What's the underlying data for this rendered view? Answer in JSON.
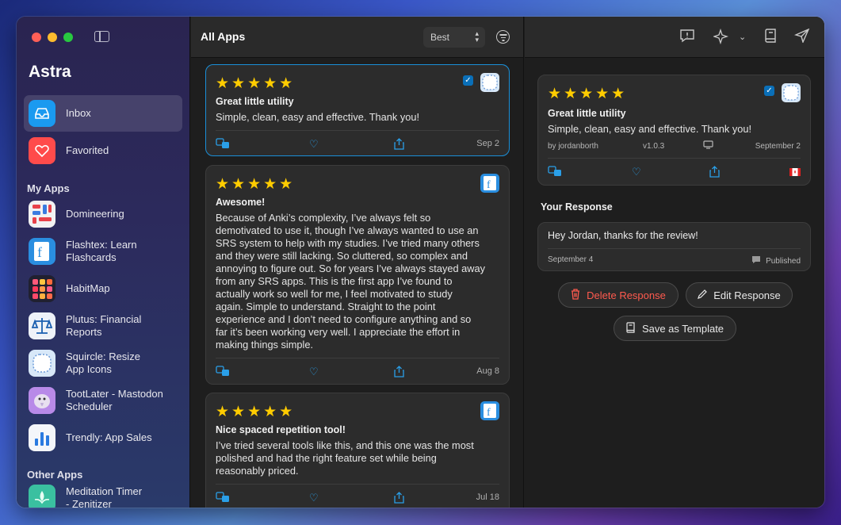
{
  "app": {
    "name": "Astra"
  },
  "sidebar": {
    "top_items": [
      {
        "label": "Inbox",
        "icon": "inbox-icon",
        "active": true
      },
      {
        "label": "Favorited",
        "icon": "heart-icon",
        "active": false
      }
    ],
    "my_apps_heading": "My Apps",
    "my_apps": [
      {
        "label": "Domineering",
        "icon": "domineering-app-icon"
      },
      {
        "label": "Flashtex: Learn Flashcards",
        "line1": "Flashtex: Learn",
        "line2": "Flashcards",
        "icon": "flashtex-app-icon"
      },
      {
        "label": "HabitMap",
        "icon": "habitmap-app-icon"
      },
      {
        "label": "Plutus: Financial Reports",
        "line1": "Plutus: Financial",
        "line2": "Reports",
        "icon": "plutus-app-icon"
      },
      {
        "label": "Squircle: Resize App Icons",
        "line1": "Squircle: Resize",
        "line2": "App Icons",
        "icon": "squircle-app-icon"
      },
      {
        "label": "TootLater - Mastodon Scheduler",
        "line1": "TootLater - Mastodon",
        "line2": "Scheduler",
        "icon": "tootlater-app-icon"
      },
      {
        "label": "Trendly: App Sales",
        "icon": "trendly-app-icon"
      }
    ],
    "other_apps_heading": "Other Apps",
    "other_apps": [
      {
        "line1": "Meditation Timer",
        "line2": "- Zenitizer",
        "icon": "meditation-app-icon"
      }
    ]
  },
  "list": {
    "title": "All Apps",
    "sort_value": "Best",
    "reviews": [
      {
        "stars": "★★★★★",
        "title": "Great little utility",
        "body": "Simple, clean, easy and effective. Thank you!",
        "date": "Sep 2",
        "selected": true,
        "checked": true
      },
      {
        "stars": "★★★★★",
        "title": "Awesome!",
        "body_lines": [
          "Because of Anki’s complexity, I’ve always felt so",
          "demotivated to use it, though I’ve always wanted to use an",
          "SRS system to help with my studies. I’ve tried many others",
          "and they were still lacking. So cluttered, so complex and",
          "annoying to figure out. So for years I’ve always stayed away",
          "from any SRS apps. This is the first app I’ve found to",
          "actually work so well for me, I feel motivated to study",
          "again. Simple to understand. Straight to the point",
          "experience and I don’t need to configure anything and so",
          "far it’s been working very well. I appreciate the effort in",
          "making things simple."
        ],
        "date": "Aug 8"
      },
      {
        "stars": "★★★★★",
        "title": "Nice spaced repetition tool!",
        "body_lines": [
          "I’ve tried several tools like this, and this one was the most",
          "polished and had the right feature set while being",
          "reasonably priced."
        ],
        "date": "Jul 18"
      }
    ]
  },
  "detail": {
    "stars": "★★★★★",
    "title": "Great little utility",
    "body": "Simple, clean, easy and effective. Thank you!",
    "author": "by jordanborth",
    "version": "v1.0.3",
    "date": "September 2",
    "response_heading": "Your Response",
    "response_text": "Hey Jordan, thanks for the review!",
    "response_date": "September 4",
    "response_status": "Published",
    "delete_label": "Delete Response",
    "edit_label": "Edit Response",
    "template_label": "Save as Template"
  },
  "colors": {
    "accent": "#1a8fd8",
    "star": "#ffcc00",
    "danger": "#ff5a4e"
  }
}
